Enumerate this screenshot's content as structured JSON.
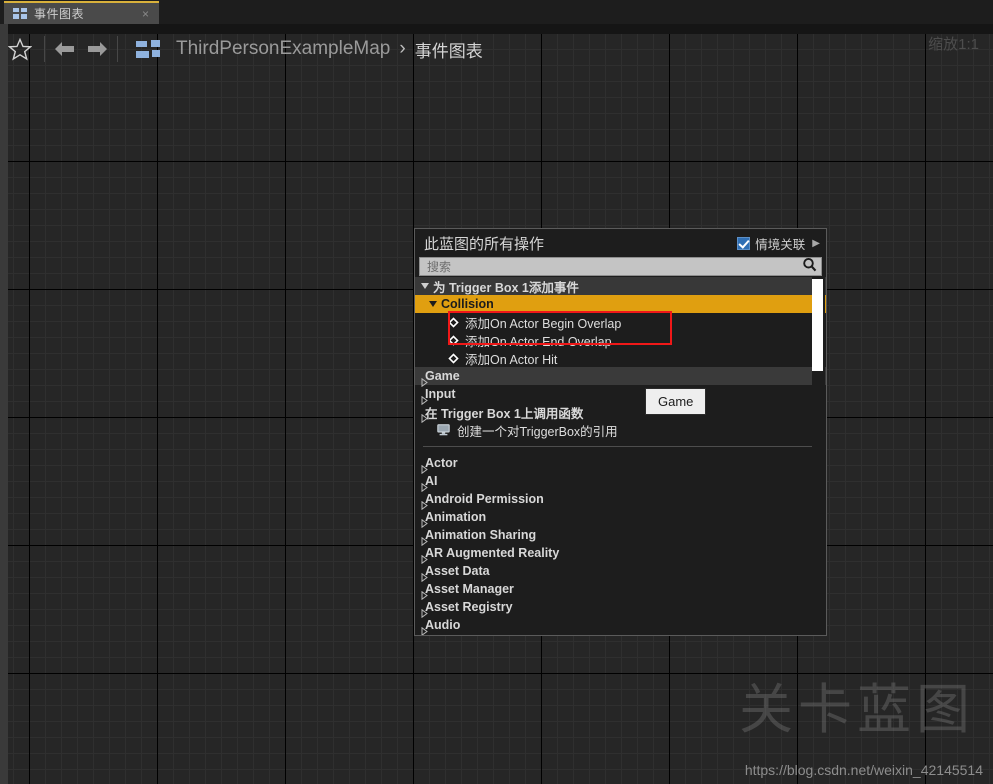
{
  "tab": {
    "label": "事件图表",
    "close_label": "×",
    "icon": "blueprint-icon"
  },
  "toolbar": {
    "favorite_icon": "star-icon",
    "back_icon": "arrow-left-icon",
    "forward_icon": "arrow-right-icon",
    "graph_icon": "blueprint-icon",
    "breadcrumb_root": "ThirdPersonExampleMap",
    "breadcrumb_separator": "›",
    "breadcrumb_current": "事件图表",
    "zoom_label": "缩放1:1"
  },
  "panel": {
    "title": "此蓝图的所有操作",
    "context_sensitive_label": "情境关联",
    "context_sensitive_checked": true,
    "context_expand_icon": "chevron-right-icon",
    "search": {
      "placeholder": "搜索",
      "value": "",
      "icon": "search-icon"
    },
    "sections": [
      {
        "type": "section",
        "label": "为 Trigger Box 1添加事件",
        "expanded": true
      },
      {
        "type": "collision",
        "label": "Collision",
        "expanded": true
      },
      {
        "type": "action",
        "label": "添加On Actor Begin Overlap",
        "icon": "event-diamond-icon",
        "highlighted": true
      },
      {
        "type": "action",
        "label": "添加On Actor End Overlap",
        "icon": "event-diamond-icon",
        "highlighted": true
      },
      {
        "type": "action",
        "label": "添加On Actor Hit",
        "icon": "event-diamond-icon",
        "highlighted": false
      },
      {
        "type": "category-hover",
        "label": "Game",
        "expanded": false
      },
      {
        "type": "category-plain",
        "label": "Input",
        "expanded": false
      },
      {
        "type": "section-plain",
        "label": "在 Trigger Box 1上调用函数",
        "expanded": false
      },
      {
        "type": "reference",
        "label": "创建一个对TriggerBox的引用",
        "icon": "monitor-icon"
      }
    ],
    "categories": [
      "Actor",
      "AI",
      "Android Permission",
      "Animation",
      "Animation Sharing",
      "AR Augmented Reality",
      "Asset Data",
      "Asset Manager",
      "Asset Registry",
      "Audio"
    ],
    "tooltip": {
      "text": "Game"
    },
    "colors": {
      "collision_highlight": "#e09f10",
      "red_annotation": "#f01818",
      "checkbox_blue": "#2f6fb5"
    }
  },
  "watermark": {
    "text": "关卡蓝图",
    "url": "https://blog.csdn.net/weixin_42145514"
  }
}
